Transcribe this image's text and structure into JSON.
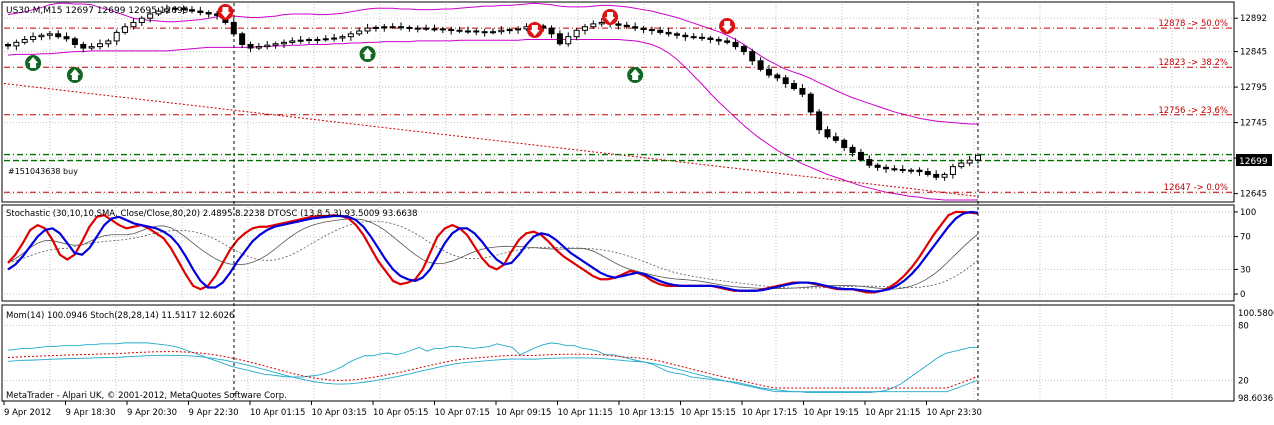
{
  "colors": {
    "background": "#ffffff",
    "grid": "#c0c0c0",
    "bull_candle": "#ffffff",
    "bear_candle": "#000000",
    "bollinger": "#cc00cc",
    "fib_line": "#c00000",
    "order_line": "#007000",
    "stoch_fast": "#e00000",
    "stoch_slow": "#0000dd",
    "momentum": "#22aacc",
    "signal_dotted": "#cc0000",
    "arrow_sell": "#dd1111",
    "arrow_buy": "#116622"
  },
  "main": {
    "title": "US30.M,M15  12697 12699 12695 12699",
    "order_label": "#151043638 buy",
    "price_tag": "12699",
    "fib_levels": [
      {
        "label": "12878 -> 50.0%",
        "price": 12878
      },
      {
        "label": "12823 -> 38.2%",
        "price": 12823
      },
      {
        "label": "12756 -> 23.6%",
        "price": 12756
      },
      {
        "label": "12647 -> 0.0%",
        "price": 12647
      }
    ]
  },
  "stoch_panel": {
    "title": "Stochastic (30,10,10,SMA, Close/Close,80,20) 2.4895 8.2238  DTOSC (13,8,5,3) 93.5009 93.6638"
  },
  "mom_panel": {
    "title": "Mom(14) 100.0946  Stoch(28,28,14) 11.5117 12.6026",
    "copyright": "MetaTrader - Alpari UK, © 2001-2012, MetaQuotes Software Corp."
  },
  "chart_data": [
    {
      "type": "candlestick",
      "symbol": "US30.M",
      "timeframe": "M15",
      "y_ticks": [
        12892,
        12845,
        12795,
        12745,
        12695,
        12645
      ],
      "ylim": [
        12636,
        12912
      ],
      "x_tick_labels": [
        "9 Apr 2012",
        "9 Apr 18:30",
        "9 Apr 20:30",
        "9 Apr 22:30",
        "10 Apr 01:15",
        "10 Apr 03:15",
        "10 Apr 05:15",
        "10 Apr 07:15",
        "10 Apr 09:15",
        "10 Apr 11:15",
        "10 Apr 13:15",
        "10 Apr 15:15",
        "10 Apr 17:15",
        "10 Apr 19:15",
        "10 Apr 21:15",
        "10 Apr 23:30"
      ],
      "close": [
        12853,
        12858,
        12862,
        12866,
        12868,
        12870,
        12866,
        12863,
        12855,
        12850,
        12852,
        12856,
        12860,
        12872,
        12880,
        12886,
        12892,
        12898,
        12902,
        12905,
        12906,
        12904,
        12902,
        12900,
        12898,
        12896,
        12886,
        12870,
        12855,
        12850,
        12852,
        12854,
        12856,
        12858,
        12860,
        12861,
        12862,
        12862,
        12863,
        12864,
        12866,
        12870,
        12874,
        12878,
        12879,
        12880,
        12880,
        12879,
        12878,
        12878,
        12877,
        12877,
        12876,
        12875,
        12874,
        12874,
        12873,
        12872,
        12873,
        12875,
        12876,
        12877,
        12880,
        12881,
        12878,
        12870,
        12856,
        12866,
        12875,
        12880,
        12884,
        12886,
        12884,
        12882,
        12880,
        12878,
        12876,
        12875,
        12872,
        12870,
        12868,
        12866,
        12865,
        12864,
        12862,
        12860,
        12858,
        12852,
        12845,
        12832,
        12820,
        12812,
        12808,
        12800,
        12793,
        12785,
        12760,
        12735,
        12725,
        12720,
        12710,
        12703,
        12693,
        12685,
        12682,
        12680,
        12679,
        12678,
        12678,
        12676,
        12672,
        12668,
        12672,
        12683,
        12688,
        12692,
        12699
      ],
      "bollinger_upper_y": [
        12897,
        12899,
        12901,
        12904,
        12907,
        12911,
        12913,
        12913,
        12912,
        12912,
        12911,
        12907,
        12904,
        12900,
        12896,
        12892,
        12890,
        12889,
        12888,
        12887,
        12887,
        12888,
        12889,
        12890,
        12892,
        12894,
        12895,
        12895,
        12894,
        12893,
        12893,
        12894,
        12895,
        12897,
        12898,
        12898,
        12898,
        12897,
        12897,
        12898,
        12899,
        12901,
        12903,
        12905,
        12906,
        12906,
        12906,
        12905,
        12905,
        12904,
        12904,
        12904,
        12905,
        12905,
        12906,
        12907,
        12908,
        12909,
        12909,
        12910,
        12910,
        12911,
        12912,
        12913,
        12912,
        12911,
        12909,
        12908,
        12908,
        12908,
        12909,
        12910,
        12910,
        12909,
        12908,
        12906,
        12904,
        12902,
        12899,
        12896,
        12893,
        12889,
        12885,
        12881,
        12877,
        12873,
        12868,
        12862,
        12855,
        12847,
        12839,
        12832,
        12826,
        12820,
        12816,
        12812,
        12807,
        12801,
        12796,
        12790,
        12785,
        12780,
        12776,
        12772,
        12768,
        12764,
        12760,
        12757,
        12754,
        12751,
        12749,
        12747,
        12746,
        12745,
        12744,
        12743,
        12743
      ],
      "bollinger_lower_y": [
        12840,
        12841,
        12841,
        12841,
        12842,
        12842,
        12843,
        12844,
        12845,
        12845,
        12846,
        12846,
        12846,
        12846,
        12846,
        12846,
        12846,
        12846,
        12846,
        12846,
        12847,
        12848,
        12849,
        12850,
        12851,
        12851,
        12851,
        12851,
        12851,
        12851,
        12852,
        12852,
        12853,
        12853,
        12854,
        12854,
        12855,
        12855,
        12855,
        12856,
        12856,
        12857,
        12857,
        12858,
        12858,
        12859,
        12859,
        12859,
        12859,
        12860,
        12860,
        12860,
        12860,
        12860,
        12861,
        12861,
        12861,
        12861,
        12861,
        12861,
        12861,
        12861,
        12862,
        12862,
        12862,
        12862,
        12862,
        12862,
        12862,
        12862,
        12862,
        12862,
        12862,
        12862,
        12861,
        12860,
        12858,
        12855,
        12850,
        12843,
        12834,
        12823,
        12811,
        12799,
        12786,
        12774,
        12763,
        12752,
        12741,
        12731,
        12722,
        12714,
        12706,
        12699,
        12693,
        12687,
        12682,
        12677,
        12672,
        12668,
        12664,
        12660,
        12656,
        12653,
        12650,
        12647,
        12645,
        12643,
        12641,
        12640,
        12638,
        12637,
        12636,
        12636,
        12636,
        12636,
        12636
      ],
      "fib_levels": [
        12878,
        12823,
        12756,
        12647
      ]
    },
    {
      "type": "line",
      "title": "Stochastic / DTOSC",
      "y_ticks": [
        100,
        70,
        30,
        0
      ],
      "ylim": [
        -6,
        106
      ],
      "series": [
        {
          "name": "DTOSC fast",
          "values": [
            38,
            48,
            62,
            78,
            84,
            80,
            66,
            48,
            42,
            48,
            64,
            82,
            94,
            96,
            90,
            84,
            80,
            82,
            84,
            80,
            74,
            68,
            56,
            40,
            24,
            10,
            6,
            10,
            22,
            38,
            54,
            66,
            74,
            80,
            82,
            82,
            84,
            86,
            88,
            90,
            92,
            94,
            95,
            95,
            96,
            95,
            92,
            84,
            72,
            56,
            40,
            28,
            16,
            12,
            14,
            18,
            30,
            50,
            70,
            80,
            84,
            80,
            72,
            58,
            44,
            34,
            30,
            36,
            52,
            66,
            74,
            76,
            72,
            64,
            54,
            46,
            40,
            34,
            28,
            22,
            18,
            18,
            20,
            24,
            28,
            26,
            22,
            16,
            12,
            10,
            10,
            10,
            10,
            10,
            10,
            10,
            8,
            6,
            4,
            4,
            4,
            4,
            6,
            8,
            10,
            12,
            14,
            14,
            14,
            12,
            10,
            8,
            6,
            6,
            6,
            4,
            2,
            2,
            4,
            8,
            14,
            22,
            32,
            44,
            58,
            72,
            84,
            96,
            100,
            100,
            99,
            98
          ]
        },
        {
          "name": "DTOSC slow",
          "values": [
            30,
            36,
            46,
            58,
            70,
            78,
            80,
            74,
            62,
            50,
            48,
            56,
            70,
            84,
            92,
            94,
            90,
            86,
            84,
            82,
            80,
            76,
            70,
            60,
            46,
            30,
            16,
            8,
            8,
            14,
            26,
            40,
            52,
            64,
            72,
            78,
            82,
            84,
            86,
            88,
            90,
            92,
            93,
            94,
            95,
            95,
            94,
            90,
            82,
            70,
            56,
            42,
            30,
            22,
            18,
            16,
            20,
            30,
            46,
            62,
            74,
            80,
            80,
            74,
            64,
            52,
            42,
            36,
            38,
            48,
            60,
            70,
            74,
            72,
            66,
            58,
            50,
            44,
            38,
            32,
            26,
            22,
            20,
            22,
            24,
            26,
            24,
            20,
            16,
            13,
            11,
            10,
            10,
            10,
            10,
            10,
            9,
            7,
            5,
            4,
            4,
            4,
            5,
            7,
            9,
            11,
            13,
            14,
            14,
            13,
            11,
            9,
            7,
            6,
            6,
            5,
            4,
            3,
            4,
            6,
            10,
            16,
            24,
            34,
            46,
            58,
            70,
            82,
            92,
            98,
            100,
            99
          ]
        }
      ]
    },
    {
      "type": "line",
      "title": "Mom / Stoch",
      "y_ticks": [
        100.5806,
        80,
        20,
        98.6036
      ],
      "ylim": [
        0,
        100
      ],
      "series": [
        {
          "name": "Mom(14)",
          "values": [
            53,
            54,
            55,
            55,
            56,
            57,
            57,
            58,
            58,
            58,
            59,
            59,
            60,
            60,
            60,
            61,
            61,
            61,
            61,
            60,
            59,
            58,
            56,
            53,
            50,
            47,
            44,
            41,
            38,
            35,
            33,
            31,
            29,
            27,
            26,
            25,
            24,
            24,
            24,
            25,
            26,
            28,
            31,
            35,
            40,
            44,
            47,
            47,
            49,
            50,
            48,
            50,
            53,
            56,
            52,
            55,
            55,
            57,
            57,
            56,
            55,
            56,
            57,
            60,
            58,
            56,
            48,
            52,
            56,
            59,
            61,
            60,
            58,
            58,
            55,
            54,
            52,
            48,
            48,
            46,
            44,
            42,
            40,
            38,
            34,
            30,
            28,
            27,
            24,
            23,
            22,
            21,
            20,
            19,
            18,
            16,
            14,
            12,
            11,
            10,
            9,
            8,
            8,
            7,
            7,
            7,
            7,
            7,
            7,
            7,
            7,
            7,
            8,
            9,
            12,
            16,
            22,
            28,
            34,
            40,
            46,
            50,
            52,
            54,
            56,
            56
          ]
        }
      ]
    }
  ]
}
